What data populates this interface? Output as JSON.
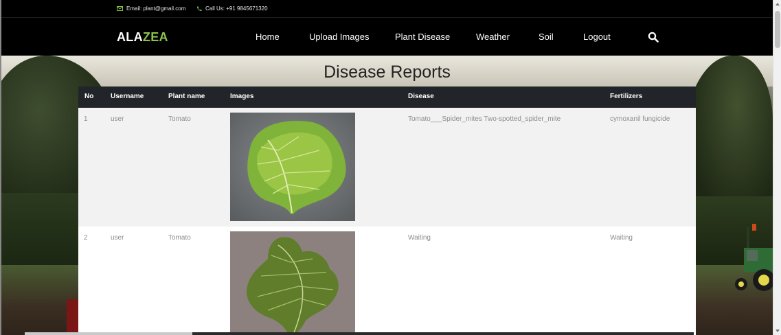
{
  "topbar": {
    "email_text": "Email: plant@gmail.com",
    "phone_text": "Call Us: +91 9845671320",
    "icon_color": "#8bc34a"
  },
  "nav": {
    "logo_part1": "ALA",
    "logo_part2": "ZEA",
    "logo_accent": "#8bc34a",
    "links": [
      "Home",
      "Upload Images",
      "Plant Disease",
      "Weather",
      "Soil",
      "Logout"
    ],
    "search_icon": "search-icon"
  },
  "page": {
    "title": "Disease Reports"
  },
  "table": {
    "headers": [
      "No",
      "Username",
      "Plant name",
      "Images",
      "Disease",
      "Fertilizers"
    ],
    "rows": [
      {
        "no": "1",
        "username": "user",
        "plant": "Tomato",
        "image": "tomato-leaf-spider-mites",
        "disease": "Tomato___Spider_mites Two-spotted_spider_mite",
        "fertilizer": "cymoxanil fungicide"
      },
      {
        "no": "2",
        "username": "user",
        "plant": "Tomato",
        "image": "tomato-leaf",
        "disease": "Waiting",
        "fertilizer": "Waiting"
      }
    ]
  }
}
